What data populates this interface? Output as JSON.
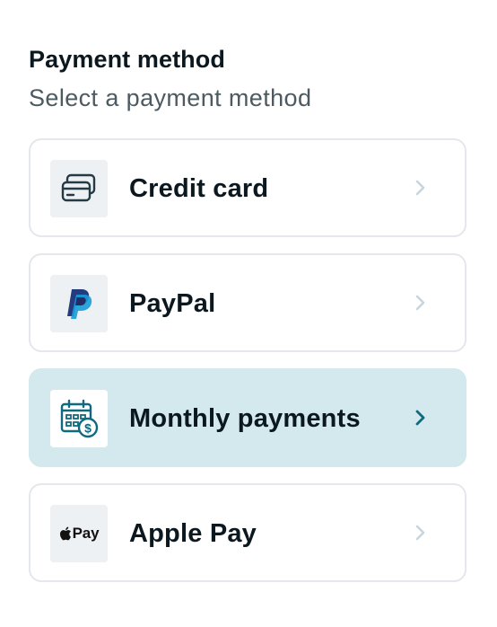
{
  "header": {
    "title": "Payment method",
    "subtitle": "Select a payment method"
  },
  "methods": [
    {
      "label": "Credit card",
      "icon": "credit-card-icon",
      "selected": false
    },
    {
      "label": "PayPal",
      "icon": "paypal-icon",
      "selected": false
    },
    {
      "label": "Monthly payments",
      "icon": "calendar-dollar-icon",
      "selected": true
    },
    {
      "label": "Apple Pay",
      "icon": "apple-pay-icon",
      "icon_text": "Pay",
      "selected": false
    }
  ],
  "colors": {
    "selected_background": "#d4e9ee",
    "accent": "#0f6a80",
    "chevron_inactive": "#c7d6dc",
    "paypal_dark": "#253b80",
    "paypal_light": "#179bd7"
  }
}
